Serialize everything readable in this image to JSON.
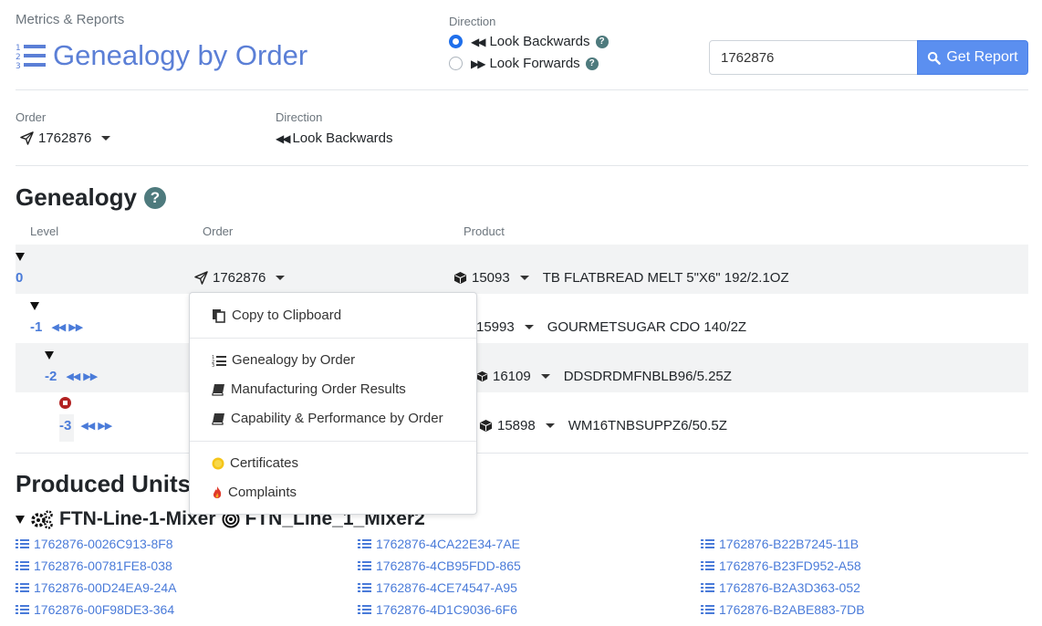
{
  "header": {
    "breadcrumb": "Metrics & Reports",
    "title": "Genealogy by Order"
  },
  "direction_picker": {
    "label": "Direction",
    "options": [
      {
        "label": "Look Backwards",
        "selected": true
      },
      {
        "label": "Look Forwards",
        "selected": false
      }
    ]
  },
  "search": {
    "value": "1762876",
    "button_label": "Get Report"
  },
  "summary": {
    "order_label": "Order",
    "order_value": "1762876",
    "direction_label": "Direction",
    "direction_value": "Look Backwards"
  },
  "genealogy": {
    "title": "Genealogy",
    "columns": [
      "Level",
      "Order",
      "Product"
    ],
    "rows": [
      {
        "level": "0",
        "order": "1762876",
        "product_id": "15093",
        "product_name": "TB FLATBREAD MELT 5\"X6\" 192/2.1OZ"
      },
      {
        "level": "-1",
        "order": "",
        "product_id": "15993",
        "product_name": "GOURMETSUGAR CDO 140/2Z"
      },
      {
        "level": "-2",
        "order": "",
        "product_id": "16109",
        "product_name": "DDSDRDMFNBLB96/5.25Z"
      },
      {
        "level": "-3",
        "order": "",
        "product_id": "15898",
        "product_name": "WM16TNBSUPPZ6/50.5Z"
      }
    ]
  },
  "context_menu": {
    "items": [
      "Copy to Clipboard",
      "Genealogy by Order",
      "Manufacturing Order Results",
      "Capability & Performance by Order",
      "Certificates",
      "Complaints"
    ]
  },
  "produced_units": {
    "title": "Produced Units",
    "group_machine": "FTN-Line-1-Mixer",
    "group_target": "FTN_Line_1_Mixer2",
    "units": [
      [
        "1762876-0026C913-8F8",
        "1762876-4CA22E34-7AE",
        "1762876-B22B7245-11B"
      ],
      [
        "1762876-00781FE8-038",
        "1762876-4CB95FDD-865",
        "1762876-B23FD952-A58"
      ],
      [
        "1762876-00D24EA9-24A",
        "1762876-4CE74547-A95",
        "1762876-B2A3D363-052"
      ],
      [
        "1762876-00F98DE3-364",
        "1762876-4D1C9036-6F6",
        "1762876-B2ABE883-7DB"
      ]
    ]
  },
  "colors": {
    "accent": "#5b8ff0",
    "link": "#4a7bd9",
    "title": "#5b7fd6"
  }
}
